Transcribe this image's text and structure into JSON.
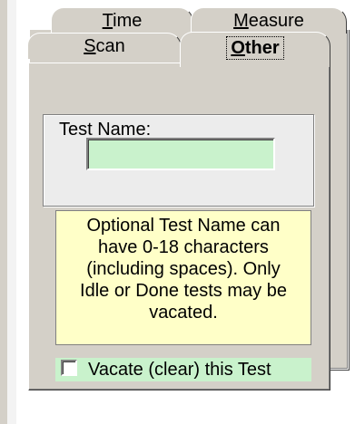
{
  "tabs": [
    {
      "label": "Time",
      "mnemonic": "T",
      "rest": "ime",
      "selected": false
    },
    {
      "label": "Measure",
      "mnemonic": "M",
      "rest": "easure",
      "selected": false
    },
    {
      "label": "Scan",
      "mnemonic": "S",
      "rest": "can",
      "selected": false
    },
    {
      "label": "Other",
      "mnemonic": "O",
      "rest": "ther",
      "selected": true
    }
  ],
  "test_name": {
    "group_label": "Test Name:",
    "value": ""
  },
  "info": {
    "lines": [
      "Optional Test Name can",
      "have 0-18 characters",
      "(including spaces).  Only",
      "Idle or Done tests may be",
      "vacated."
    ]
  },
  "vacate": {
    "label": "Vacate (clear) this Test",
    "checked": false
  },
  "colors": {
    "input_bg": "#c9f2cc",
    "info_bg": "#ffffc8",
    "panel_bg": "#d4d0c8"
  }
}
